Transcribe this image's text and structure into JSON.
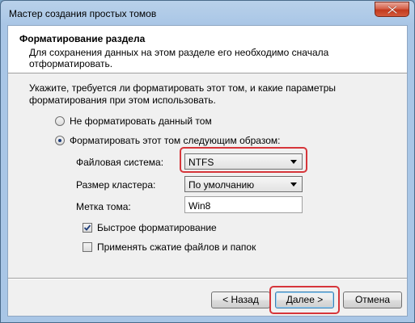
{
  "window": {
    "title": "Мастер создания простых томов"
  },
  "header": {
    "title": "Форматирование раздела",
    "subtitle": "Для сохранения данных на этом разделе его необходимо сначала отформатировать."
  },
  "body": {
    "intro": "Укажите, требуется ли форматировать этот том, и какие параметры форматирования при этом использовать.",
    "option_no_format": "Не форматировать данный том",
    "option_format": "Форматировать этот том следующим образом:",
    "filesystem_label": "Файловая система:",
    "filesystem_value": "NTFS",
    "cluster_label": "Размер кластера:",
    "cluster_value": "По умолчанию",
    "volume_label_label": "Метка тома:",
    "volume_label_value": "Win8",
    "quick_format_label": "Быстрое форматирование",
    "quick_format_checked": true,
    "compression_label": "Применять сжатие файлов и папок",
    "compression_checked": false
  },
  "buttons": {
    "back": "< Назад",
    "next": "Далее >",
    "cancel": "Отмена"
  },
  "colors": {
    "highlight": "#d6353a"
  }
}
